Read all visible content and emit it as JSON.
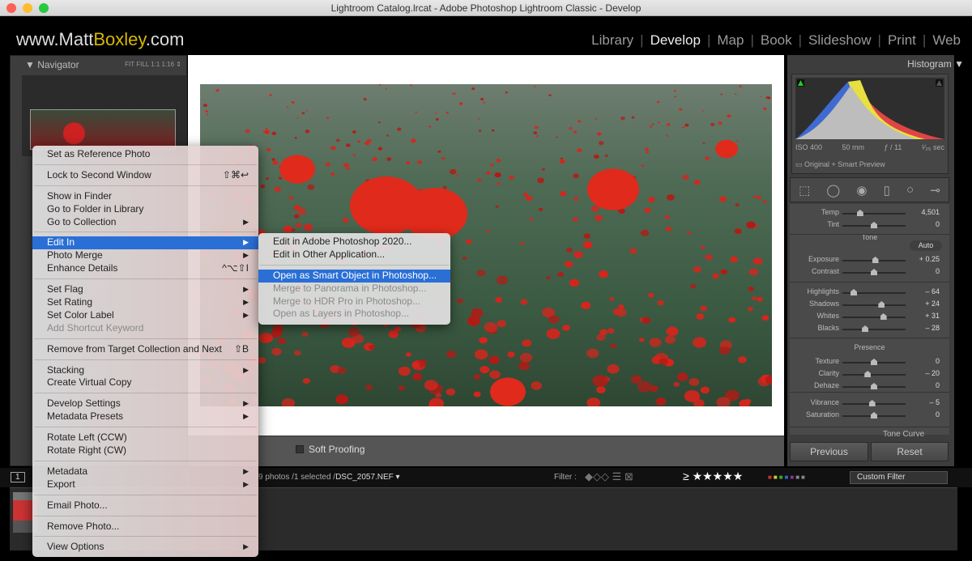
{
  "window": {
    "title": "Lightroom Catalog.lrcat - Adobe Photoshop Lightroom Classic - Develop"
  },
  "logo": {
    "prefix": "www.Matt",
    "highlight": "Boxley",
    "suffix": ".com"
  },
  "modules": [
    "Library",
    "Develop",
    "Map",
    "Book",
    "Slideshow",
    "Print",
    "Web"
  ],
  "active_module": "Develop",
  "navigator": {
    "title": "Navigator",
    "zoom": "FIT   FILL   1:1   1:16 ⇕"
  },
  "histogram": {
    "title": "Histogram ▼",
    "iso": "ISO 400",
    "focal": "50 mm",
    "aperture": "ƒ / 11",
    "shutter": "¹⁄₂₅ sec",
    "preview": "Original + Smart Preview"
  },
  "tools": [
    "crop-icon",
    "spot-removal-icon",
    "red-eye-icon",
    "graduated-filter-icon",
    "radial-filter-icon",
    "brush-icon"
  ],
  "sliders": [
    {
      "label": "Temp",
      "value": "4,501",
      "pos": 0.28
    },
    {
      "label": "Tint",
      "value": "0",
      "pos": 0.5
    },
    {
      "label": "Exposure",
      "value": "+ 0.25",
      "pos": 0.52
    },
    {
      "label": "Contrast",
      "value": "0",
      "pos": 0.5
    },
    {
      "label": "Highlights",
      "value": "– 64",
      "pos": 0.18
    },
    {
      "label": "Shadows",
      "value": "+ 24",
      "pos": 0.62
    },
    {
      "label": "Whites",
      "value": "+ 31",
      "pos": 0.65
    },
    {
      "label": "Blacks",
      "value": "– 28",
      "pos": 0.36
    },
    {
      "label": "Texture",
      "value": "0",
      "pos": 0.5
    },
    {
      "label": "Clarity",
      "value": "– 20",
      "pos": 0.4
    },
    {
      "label": "Dehaze",
      "value": "0",
      "pos": 0.5
    },
    {
      "label": "Vibrance",
      "value": "– 5",
      "pos": 0.47
    },
    {
      "label": "Saturation",
      "value": "0",
      "pos": 0.5
    }
  ],
  "sections": {
    "tone": "Tone",
    "auto": "Auto",
    "presence": "Presence",
    "tone_curve": "Tone Curve"
  },
  "buttons": {
    "previous": "Previous",
    "reset": "Reset"
  },
  "toolbar": {
    "soft_proofing": "Soft Proofing"
  },
  "filterbar": {
    "page": "1",
    "info": "9 photos /1 selected /",
    "file": "DSC_2057.NEF ▾",
    "filter": "Filter :",
    "rating": "≥ ★★★★★",
    "custom": "Custom Filter"
  },
  "menu": [
    {
      "label": "Set as Reference Photo"
    },
    {
      "sep": true
    },
    {
      "label": "Lock to Second Window",
      "shortcut": "⇧⌘↩"
    },
    {
      "sep": true
    },
    {
      "label": "Show in Finder"
    },
    {
      "label": "Go to Folder in Library"
    },
    {
      "label": "Go to Collection",
      "arrow": true
    },
    {
      "sep": true
    },
    {
      "label": "Edit In",
      "arrow": true,
      "highlight": true
    },
    {
      "label": "Photo Merge",
      "arrow": true
    },
    {
      "label": "Enhance Details",
      "shortcut": "^⌥⇧I"
    },
    {
      "sep": true
    },
    {
      "label": "Set Flag",
      "arrow": true
    },
    {
      "label": "Set Rating",
      "arrow": true
    },
    {
      "label": "Set Color Label",
      "arrow": true
    },
    {
      "label": "Add Shortcut Keyword",
      "disabled": true
    },
    {
      "sep": true
    },
    {
      "label": "Remove from Target Collection and Next",
      "shortcut": "⇧B"
    },
    {
      "sep": true
    },
    {
      "label": "Stacking",
      "arrow": true
    },
    {
      "label": "Create Virtual Copy"
    },
    {
      "sep": true
    },
    {
      "label": "Develop Settings",
      "arrow": true
    },
    {
      "label": "Metadata Presets",
      "arrow": true
    },
    {
      "sep": true
    },
    {
      "label": "Rotate Left (CCW)"
    },
    {
      "label": "Rotate Right (CW)"
    },
    {
      "sep": true
    },
    {
      "label": "Metadata",
      "arrow": true
    },
    {
      "label": "Export",
      "arrow": true
    },
    {
      "sep": true
    },
    {
      "label": "Email Photo..."
    },
    {
      "sep": true
    },
    {
      "label": "Remove Photo..."
    },
    {
      "sep": true
    },
    {
      "label": "View Options",
      "arrow": true
    }
  ],
  "submenu": [
    {
      "label": "Edit in Adobe Photoshop 2020..."
    },
    {
      "label": "Edit in Other Application..."
    },
    {
      "sep": true
    },
    {
      "label": "Open as Smart Object in Photoshop...",
      "highlight": true
    },
    {
      "label": "Merge to Panorama in Photoshop...",
      "disabled": true
    },
    {
      "label": "Merge to HDR Pro in Photoshop...",
      "disabled": true
    },
    {
      "label": "Open as Layers in Photoshop...",
      "disabled": true
    }
  ]
}
